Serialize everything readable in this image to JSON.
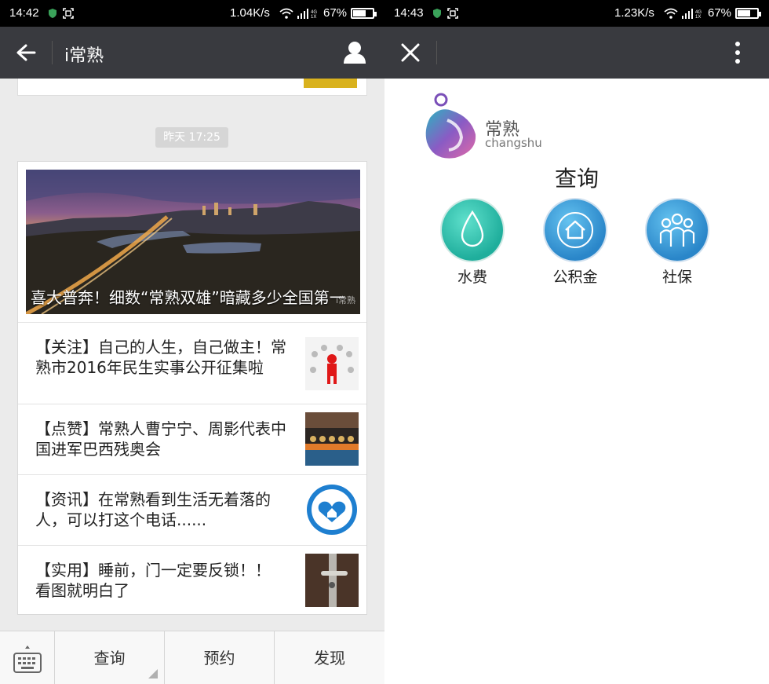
{
  "left": {
    "status": {
      "time": "14:42",
      "speed": "1.04K/s",
      "battery": "67%"
    },
    "header": {
      "title": "i常熟"
    },
    "timestamp": "昨天 17:25",
    "hero": {
      "caption": "喜大普奔！细数“常熟双雄”暗藏多少全国第一",
      "watermark": "i常熟"
    },
    "articles": [
      {
        "title": "【关注】自己的人生，自己做主！常熟市2016年民生实事公开征集啦"
      },
      {
        "title": "【点赞】常熟人曹宁宁、周影代表中国进军巴西残奥会"
      },
      {
        "title": "【资讯】在常熟看到生活无着落的人，可以打这个电话......"
      },
      {
        "title": "【实用】睡前，门一定要反锁！！看图就明白了"
      }
    ],
    "menu": [
      {
        "label": "查询"
      },
      {
        "label": "预约"
      },
      {
        "label": "发现"
      }
    ]
  },
  "right": {
    "status": {
      "time": "14:43",
      "speed": "1.23K/s",
      "battery": "67%"
    },
    "logo": {
      "cn": "常熟",
      "en": "changshu"
    },
    "section_title": "查询",
    "services": [
      {
        "label": "水费",
        "icon": "water-drop-icon",
        "color": "#1fae9c"
      },
      {
        "label": "公积金",
        "icon": "house-icon",
        "color": "#2a86c9"
      },
      {
        "label": "社保",
        "icon": "people-icon",
        "color": "#2a86c9"
      }
    ]
  }
}
